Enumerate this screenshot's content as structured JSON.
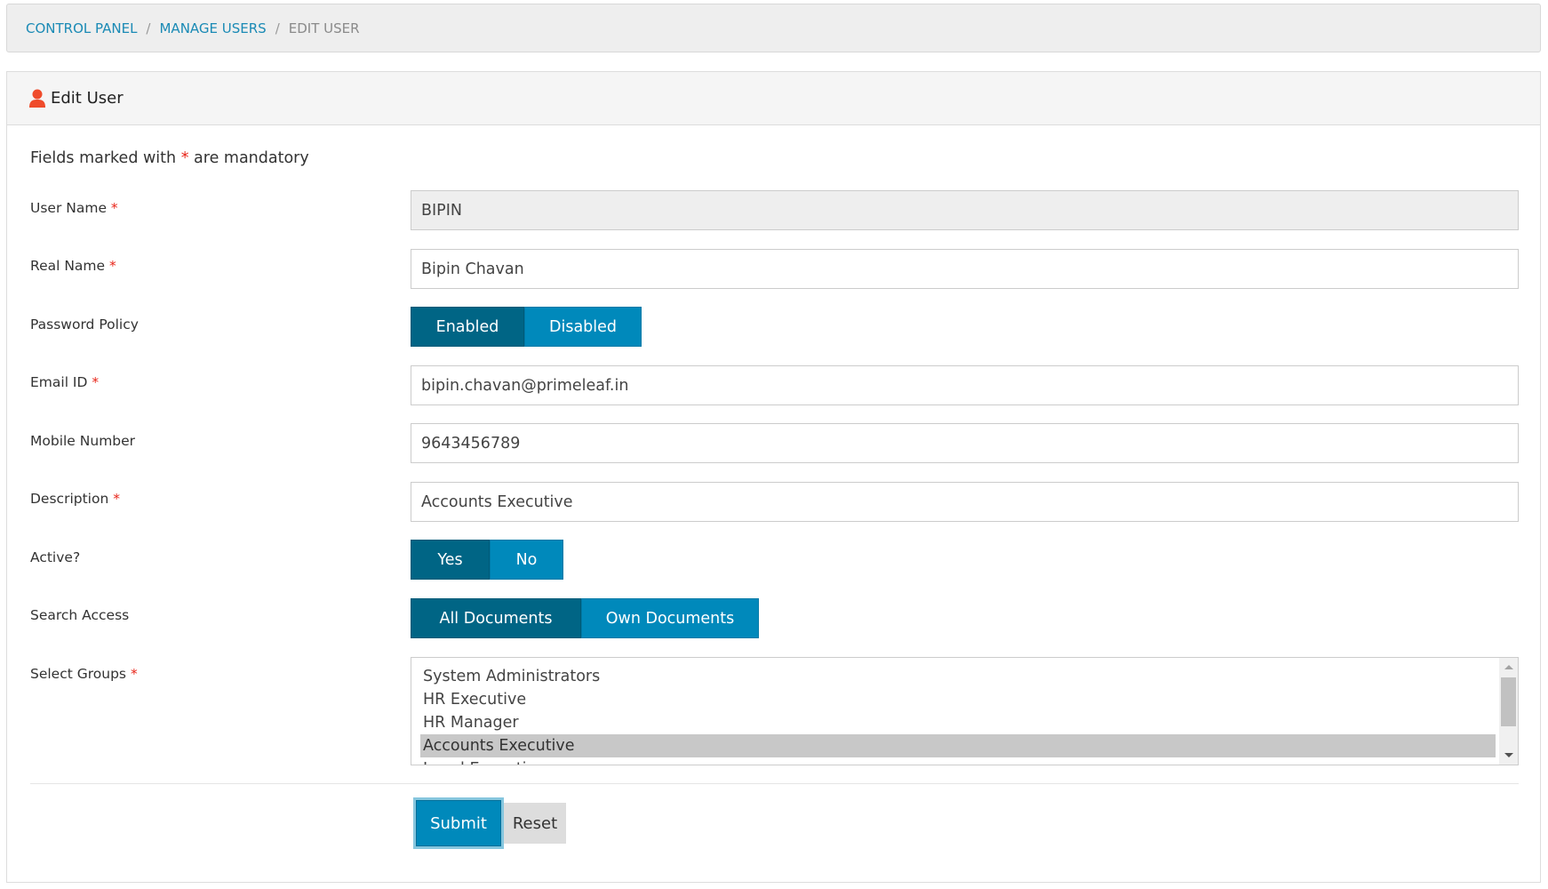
{
  "breadcrumb": {
    "items": [
      {
        "label": "CONTROL PANEL",
        "link": true
      },
      {
        "label": "MANAGE USERS",
        "link": true
      },
      {
        "label": "EDIT USER",
        "link": false
      }
    ],
    "separator": "/"
  },
  "panel": {
    "title": "Edit User",
    "icon": "user-icon",
    "mandatory_note_prefix": "Fields marked with",
    "mandatory_star": "*",
    "mandatory_note_suffix": "are mandatory"
  },
  "form": {
    "user_name": {
      "label": "User Name",
      "required": "*",
      "value": "BIPIN",
      "readonly": true
    },
    "real_name": {
      "label": "Real Name",
      "required": "*",
      "value": "Bipin Chavan"
    },
    "password_policy": {
      "label": "Password Policy",
      "options": [
        "Enabled",
        "Disabled"
      ],
      "selected": "Enabled"
    },
    "email": {
      "label": "Email ID",
      "required": "*",
      "value": "bipin.chavan@primeleaf.in"
    },
    "mobile": {
      "label": "Mobile Number",
      "value": "9643456789"
    },
    "description": {
      "label": "Description",
      "required": "*",
      "value": "Accounts Executive"
    },
    "active": {
      "label": "Active?",
      "options": [
        "Yes",
        "No"
      ],
      "selected": "Yes"
    },
    "search_access": {
      "label": "Search Access",
      "options": [
        "All Documents",
        "Own Documents"
      ],
      "selected": "All Documents"
    },
    "groups": {
      "label": "Select Groups",
      "required": "*",
      "options": [
        "System Administrators",
        "HR Executive",
        "HR Manager",
        "Accounts Executive",
        "Legal Executive"
      ],
      "selected": "Accounts Executive"
    }
  },
  "actions": {
    "submit_label": "Submit",
    "reset_label": "Reset"
  },
  "colors": {
    "toggle_active": "#006585",
    "toggle_inactive": "#0089bb",
    "link": "#1a8ab5",
    "required": "#e8261a",
    "user_icon": "#ef4b2b"
  }
}
